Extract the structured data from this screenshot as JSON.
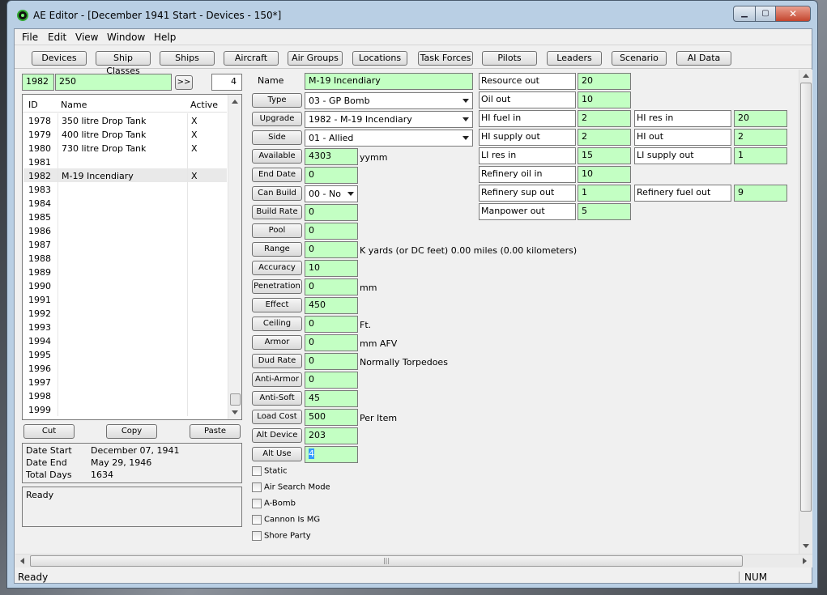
{
  "window": {
    "title": "AE Editor - [December 1941 Start - Devices - 150*]"
  },
  "menu": [
    "File",
    "Edit",
    "View",
    "Window",
    "Help"
  ],
  "toolbar": [
    "Devices",
    "Ship Classes",
    "Ships",
    "Aircraft",
    "Air Groups",
    "Locations",
    "Task Forces",
    "Pilots",
    "Leaders",
    "Scenario",
    "AI Data"
  ],
  "top": {
    "id": "1982",
    "value": "250",
    "go_label": ">>",
    "count": "4"
  },
  "list": {
    "headers": [
      "ID",
      "Name",
      "Active"
    ],
    "rows": [
      {
        "id": "1978",
        "name": "350 litre Drop Tank",
        "active": "X"
      },
      {
        "id": "1979",
        "name": "400 litre Drop Tank",
        "active": "X"
      },
      {
        "id": "1980",
        "name": "730 litre Drop Tank",
        "active": "X"
      },
      {
        "id": "1981",
        "name": "",
        "active": ""
      },
      {
        "id": "1982",
        "name": "M-19 Incendiary",
        "active": "X"
      },
      {
        "id": "1983",
        "name": "",
        "active": ""
      },
      {
        "id": "1984",
        "name": "",
        "active": ""
      },
      {
        "id": "1985",
        "name": "",
        "active": ""
      },
      {
        "id": "1986",
        "name": "",
        "active": ""
      },
      {
        "id": "1987",
        "name": "",
        "active": ""
      },
      {
        "id": "1988",
        "name": "",
        "active": ""
      },
      {
        "id": "1989",
        "name": "",
        "active": ""
      },
      {
        "id": "1990",
        "name": "",
        "active": ""
      },
      {
        "id": "1991",
        "name": "",
        "active": ""
      },
      {
        "id": "1992",
        "name": "",
        "active": ""
      },
      {
        "id": "1993",
        "name": "",
        "active": ""
      },
      {
        "id": "1994",
        "name": "",
        "active": ""
      },
      {
        "id": "1995",
        "name": "",
        "active": ""
      },
      {
        "id": "1996",
        "name": "",
        "active": ""
      },
      {
        "id": "1997",
        "name": "",
        "active": ""
      },
      {
        "id": "1998",
        "name": "",
        "active": ""
      },
      {
        "id": "1999",
        "name": "",
        "active": ""
      }
    ]
  },
  "clip": {
    "cut": "Cut",
    "copy": "Copy",
    "paste": "Paste"
  },
  "info": {
    "date_start_label": "Date Start",
    "date_start": "December 07, 1941",
    "date_end_label": "Date End",
    "date_end": "May 29, 1946",
    "total_days_label": "Total Days",
    "total_days": "1634"
  },
  "log": "Ready",
  "fields": {
    "name_label": "Name",
    "name": "M-19 Incendiary",
    "type_label": "Type",
    "type": "03 - GP Bomb",
    "upgrade_label": "Upgrade",
    "upgrade": "1982 - M-19 Incendiary",
    "side_label": "Side",
    "side": "01 - Allied",
    "available_label": "Available",
    "available": "4303",
    "available_unit": "yymm",
    "end_date_label": "End Date",
    "end_date": "0",
    "can_build_label": "Can Build",
    "can_build": "00 - No",
    "build_rate_label": "Build Rate",
    "build_rate": "0",
    "pool_label": "Pool",
    "pool": "0",
    "range_label": "Range",
    "range": "0",
    "range_note": "K yards  (or DC feet)  0.00 miles  (0.00 kilometers)",
    "accuracy_label": "Accuracy",
    "accuracy": "10",
    "penetration_label": "Penetration",
    "penetration": "0",
    "penetration_unit": "mm",
    "effect_label": "Effect",
    "effect": "450",
    "ceiling_label": "Ceiling",
    "ceiling": "0",
    "ceiling_unit": "Ft.",
    "armor_label": "Armor",
    "armor": "0",
    "armor_unit": "mm AFV",
    "dud_rate_label": "Dud Rate",
    "dud_rate": "0",
    "dud_note": "Normally Torpedoes",
    "anti_armor_label": "Anti-Armor",
    "anti_armor": "0",
    "anti_soft_label": "Anti-Soft",
    "anti_soft": "45",
    "load_cost_label": "Load Cost",
    "load_cost": "500",
    "load_unit": "Per Item",
    "alt_device_label": "Alt Device",
    "alt_device": "203",
    "alt_use_label": "Alt Use",
    "alt_use": "4"
  },
  "checks": [
    "Static",
    "Air Search Mode",
    "A-Bomb",
    "Cannon Is MG",
    "Shore Party"
  ],
  "resources": {
    "resource_out_label": "Resource out",
    "resource_out": "20",
    "oil_out_label": "Oil out",
    "oil_out": "10",
    "hi_fuel_in_label": "HI fuel in",
    "hi_fuel_in": "2",
    "hi_res_in_label": "HI res in",
    "hi_res_in": "20",
    "hi_supply_out_label": "HI supply out",
    "hi_supply_out": "2",
    "hi_out_label": "HI out",
    "hi_out": "2",
    "li_res_in_label": "LI res in",
    "li_res_in": "15",
    "li_supply_out_label": "LI supply out",
    "li_supply_out": "1",
    "refinery_oil_in_label": "Refinery oil in",
    "refinery_oil_in": "10",
    "refinery_sup_out_label": "Refinery sup out",
    "refinery_sup_out": "1",
    "refinery_fuel_out_label": "Refinery fuel out",
    "refinery_fuel_out": "9",
    "manpower_out_label": "Manpower out",
    "manpower_out": "5"
  },
  "statusbar": {
    "text": "Ready",
    "num": "NUM"
  },
  "colors": {
    "field_green": "#c3ffc3",
    "close_red": "#c4452e"
  }
}
